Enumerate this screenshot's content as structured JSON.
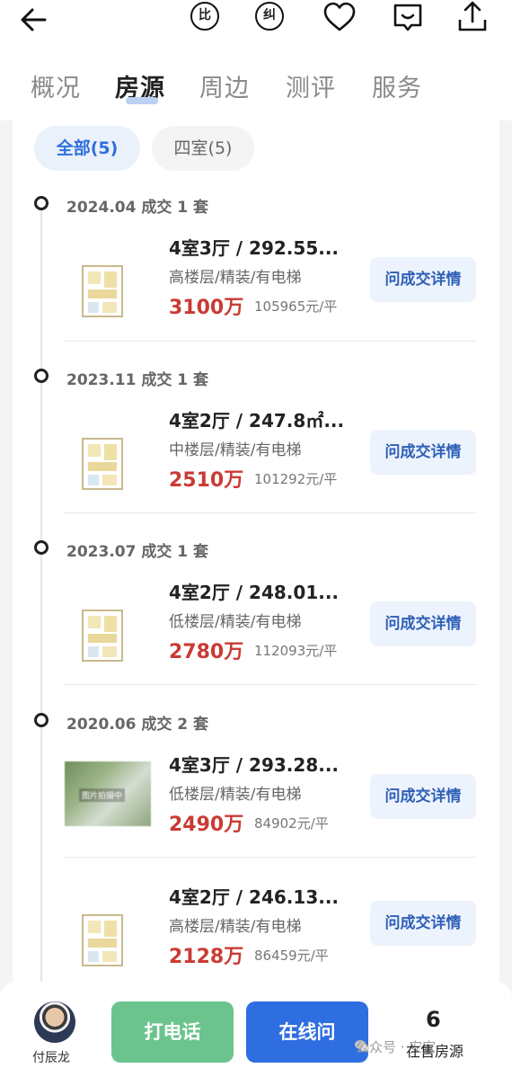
{
  "header": {
    "icons": [
      "back-arrow-icon",
      "compare-icon",
      "correction-icon",
      "favorite-heart-icon",
      "message-icon",
      "share-icon"
    ],
    "compare_label": "比",
    "correction_label": "纠"
  },
  "tabs": [
    "概况",
    "房源",
    "周边",
    "测评",
    "服务"
  ],
  "active_tab": "房源",
  "filters": {
    "all": "全部(5)",
    "four_room": "四室(5)"
  },
  "groups": [
    {
      "heading": "2024.04 成交 1 套",
      "listings": [
        {
          "title": "4室3厅 / 292.55...",
          "subtitle": "高楼层/精装/有电梯",
          "price": "3100万",
          "unit_price": "105965元/平",
          "button": "问成交详情",
          "image": "floorplan"
        }
      ]
    },
    {
      "heading": "2023.11 成交 1 套",
      "listings": [
        {
          "title": "4室2厅 / 247.8㎡...",
          "subtitle": "中楼层/精装/有电梯",
          "price": "2510万",
          "unit_price": "101292元/平",
          "button": "问成交详情",
          "image": "floorplan"
        }
      ]
    },
    {
      "heading": "2023.07 成交 1 套",
      "listings": [
        {
          "title": "4室2厅 / 248.01...",
          "subtitle": "低楼层/精装/有电梯",
          "price": "2780万",
          "unit_price": "112093元/平",
          "button": "问成交详情",
          "image": "floorplan"
        }
      ]
    },
    {
      "heading": "2020.06 成交 2 套",
      "listings": [
        {
          "title": "4室3厅 / 293.28...",
          "subtitle": "低楼层/精装/有电梯",
          "price": "2490万",
          "unit_price": "84902元/平",
          "button": "问成交详情",
          "image": "photo",
          "photo_tag": "图片拍摄中"
        },
        {
          "title": "4室2厅 / 246.13...",
          "subtitle": "高楼层/精装/有电梯",
          "price": "2128万",
          "unit_price": "86459元/平",
          "button": "问成交详情",
          "image": "floorplan"
        }
      ]
    }
  ],
  "bottom_bar": {
    "agent_name": "付辰龙",
    "call_label": "打电话",
    "chat_label": "在线问",
    "listing_count": "6",
    "listing_count_label": "在售房源",
    "watermark": "公众号 · 安家"
  },
  "colors": {
    "price_red": "#c93b34",
    "accent_blue": "#2f6ee0",
    "call_green": "#6bc48e"
  }
}
